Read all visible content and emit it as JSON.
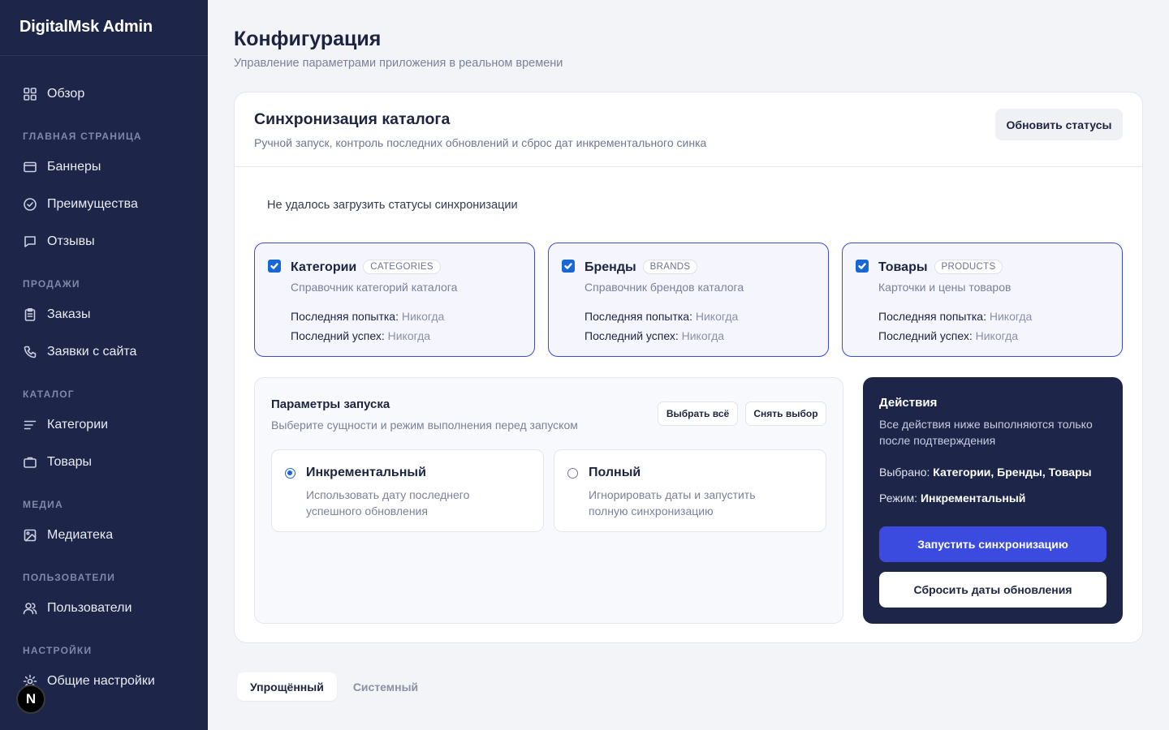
{
  "brand": "DigitalMsk Admin",
  "sidebar": {
    "overview": "Обзор",
    "sections": {
      "home": "Главная страница",
      "sales": "Продажи",
      "catalog": "Каталог",
      "media": "Медиа",
      "users": "Пользователи",
      "settings": "Настройки"
    },
    "items": {
      "banners": "Баннеры",
      "advantages": "Преимущества",
      "reviews": "Отзывы",
      "orders": "Заказы",
      "requests": "Заявки с сайта",
      "categories": "Категории",
      "products": "Товары",
      "media_library": "Медиатека",
      "users": "Пользователи",
      "general_settings": "Общие настройки"
    }
  },
  "next_badge": "N",
  "page": {
    "title": "Конфигурация",
    "subtitle": "Управление параметрами приложения в реальном времени"
  },
  "sync": {
    "title": "Синхронизация каталога",
    "subtitle": "Ручной запуск, контроль последних обновлений и сброс дат инкрементального синка",
    "refresh_label": "Обновить статусы",
    "error": "Не удалось загрузить статусы синхронизации",
    "last_attempt_label": "Последняя попытка:",
    "last_success_label": "Последний успех:",
    "entities": [
      {
        "name": "Категории",
        "code": "CATEGORIES",
        "desc": "Справочник категорий каталога",
        "last_attempt": "Никогда",
        "last_success": "Никогда",
        "checked": true
      },
      {
        "name": "Бренды",
        "code": "BRANDS",
        "desc": "Справочник брендов каталога",
        "last_attempt": "Никогда",
        "last_success": "Никогда",
        "checked": true
      },
      {
        "name": "Товары",
        "code": "PRODUCTS",
        "desc": "Карточки и цены товаров",
        "last_attempt": "Никогда",
        "last_success": "Никогда",
        "checked": true
      }
    ]
  },
  "params": {
    "title": "Параметры запуска",
    "subtitle": "Выберите сущности и режим выполнения перед запуском",
    "select_all": "Выбрать всё",
    "deselect": "Снять выбор",
    "modes": [
      {
        "title": "Инкрементальный",
        "desc": "Использовать дату последнего успешного обновления",
        "selected": true
      },
      {
        "title": "Полный",
        "desc": "Игнорировать даты и запустить полную синхронизацию",
        "selected": false
      }
    ]
  },
  "actions": {
    "title": "Действия",
    "desc": "Все действия ниже выполняются только после подтверждения",
    "selected_label": "Выбрано:",
    "selected_value": "Категории, Бренды, Товары",
    "mode_label": "Режим:",
    "mode_value": "Инкрементальный",
    "run": "Запустить синхронизацию",
    "reset": "Сбросить даты обновления"
  },
  "tabs": [
    {
      "label": "Упрощённый",
      "active": true
    },
    {
      "label": "Системный",
      "active": false
    }
  ],
  "colors": {
    "sidebar_bg": "#1d2648",
    "accent": "#3b4be0",
    "checkbox": "#1967d2"
  }
}
